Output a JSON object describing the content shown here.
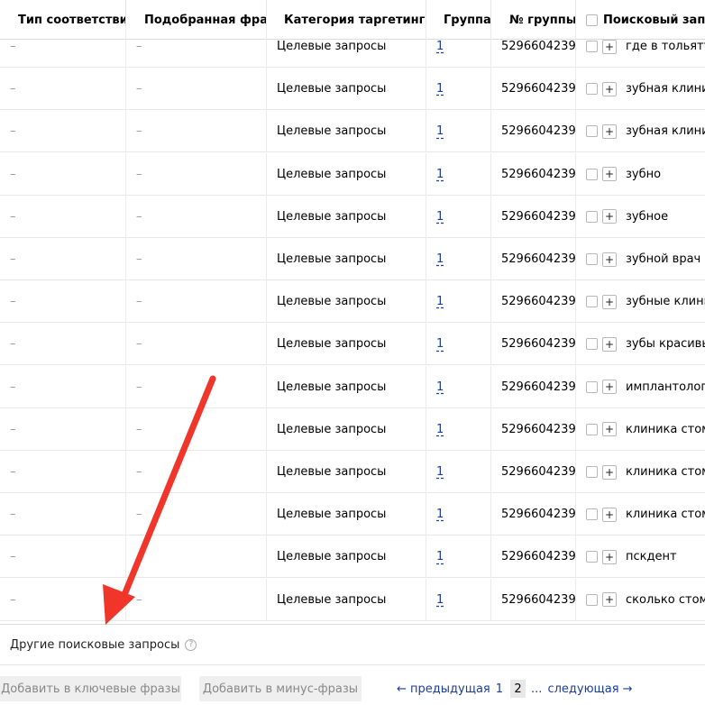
{
  "columns": {
    "match_type": "Тип соответствия",
    "matched_phrase": "Подобранная фраза",
    "targeting_category": "Категория таргетинга",
    "group": "Группа",
    "group_no": "№ группы",
    "search_query": "Поисковый запрос"
  },
  "rows": [
    {
      "match_type": "–",
      "matched_phrase": "–",
      "category": "Целевые запросы",
      "group": "1",
      "group_no": "5296604239",
      "query": "где в тольятти"
    },
    {
      "match_type": "–",
      "matched_phrase": "–",
      "category": "Целевые запросы",
      "group": "1",
      "group_no": "5296604239",
      "query": "зубная клиника"
    },
    {
      "match_type": "–",
      "matched_phrase": "–",
      "category": "Целевые запросы",
      "group": "1",
      "group_no": "5296604239",
      "query": "зубная клиника"
    },
    {
      "match_type": "–",
      "matched_phrase": "–",
      "category": "Целевые запросы",
      "group": "1",
      "group_no": "5296604239",
      "query": "зубно"
    },
    {
      "match_type": "–",
      "matched_phrase": "–",
      "category": "Целевые запросы",
      "group": "1",
      "group_no": "5296604239",
      "query": "зубное"
    },
    {
      "match_type": "–",
      "matched_phrase": "–",
      "category": "Целевые запросы",
      "group": "1",
      "group_no": "5296604239",
      "query": "зубной врач"
    },
    {
      "match_type": "–",
      "matched_phrase": "–",
      "category": "Целевые запросы",
      "group": "1",
      "group_no": "5296604239",
      "query": "зубные клиники"
    },
    {
      "match_type": "–",
      "matched_phrase": "–",
      "category": "Целевые запросы",
      "group": "1",
      "group_no": "5296604239",
      "query": "зубы красивые"
    },
    {
      "match_type": "–",
      "matched_phrase": "–",
      "category": "Целевые запросы",
      "group": "1",
      "group_no": "5296604239",
      "query": "имплантология"
    },
    {
      "match_type": "–",
      "matched_phrase": "–",
      "category": "Целевые запросы",
      "group": "1",
      "group_no": "5296604239",
      "query": "клиника стома"
    },
    {
      "match_type": "–",
      "matched_phrase": "–",
      "category": "Целевые запросы",
      "group": "1",
      "group_no": "5296604239",
      "query": "клиника стома"
    },
    {
      "match_type": "–",
      "matched_phrase": "–",
      "category": "Целевые запросы",
      "group": "1",
      "group_no": "5296604239",
      "query": "клиника стома"
    },
    {
      "match_type": "–",
      "matched_phrase": "–",
      "category": "Целевые запросы",
      "group": "1",
      "group_no": "5296604239",
      "query": "пскдент"
    },
    {
      "match_type": "–",
      "matched_phrase": "–",
      "category": "Целевые запросы",
      "group": "1",
      "group_no": "5296604239",
      "query": "сколько стома"
    }
  ],
  "other_queries": {
    "label": "Другие поисковые запросы",
    "help_icon": "?"
  },
  "buttons": {
    "add_keywords": "Добавить в ключевые фразы",
    "add_negative": "Добавить в минус-фразы"
  },
  "pagination": {
    "prev": "← предыдущая",
    "pages": [
      "1",
      "2"
    ],
    "current": "2",
    "ellipsis": "...",
    "next": "следующая →"
  },
  "colors": {
    "link": "#1a3e9a",
    "arrow": "#f0362b"
  }
}
